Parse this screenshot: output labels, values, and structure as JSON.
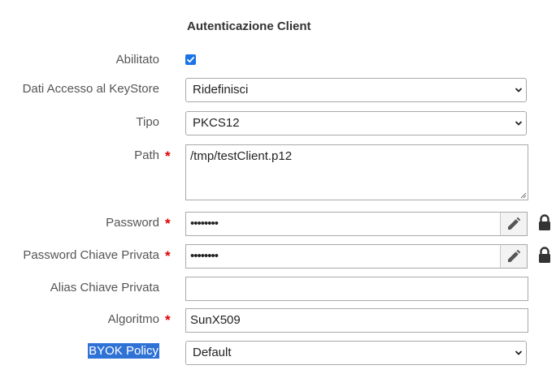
{
  "section": {
    "title": "Autenticazione Client"
  },
  "fields": {
    "abilitato": {
      "label": "Abilitato",
      "checked": true
    },
    "dati_accesso": {
      "label": "Dati Accesso al KeyStore",
      "value": "Ridefinisci"
    },
    "tipo": {
      "label": "Tipo",
      "value": "PKCS12"
    },
    "path": {
      "label": "Path",
      "value": "/tmp/testClient.p12"
    },
    "password": {
      "label": "Password",
      "value": "••••••••"
    },
    "password_chiave": {
      "label": "Password Chiave Privata",
      "value": "••••••••"
    },
    "alias": {
      "label": "Alias Chiave Privata",
      "value": ""
    },
    "algoritmo": {
      "label": "Algoritmo",
      "value": "SunX509"
    },
    "byok": {
      "label": "BYOK Policy",
      "value": "Default"
    }
  },
  "required_mark": "*",
  "icons": {
    "edit": "pencil-icon",
    "lock": "lock-icon",
    "caret": "chevron-down-icon"
  },
  "colors": {
    "required": "#e00000",
    "checkbox": "#1a73e8",
    "selection": "#2f72d6"
  }
}
